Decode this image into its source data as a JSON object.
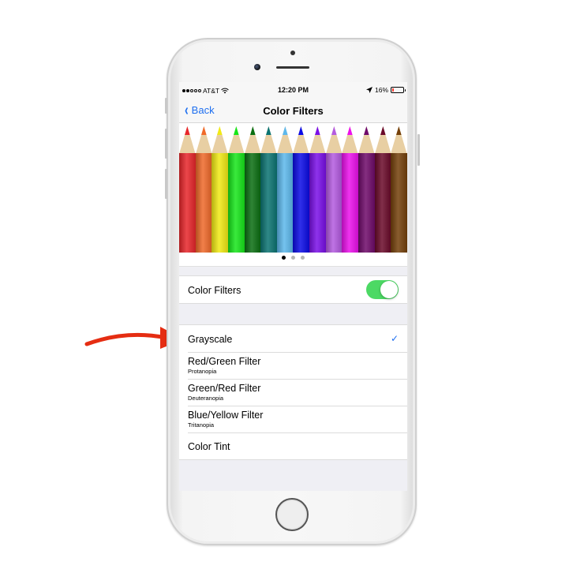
{
  "status_bar": {
    "carrier": "AT&T",
    "signal_bars_filled": 2,
    "signal_bars_total": 5,
    "time": "12:20 PM",
    "battery_percent": "16%",
    "battery_level": 0.16,
    "icons": [
      "wifi-icon",
      "location-arrow-icon",
      "battery-icon"
    ]
  },
  "nav": {
    "back_label": "Back",
    "title": "Color Filters"
  },
  "carousel": {
    "pencil_colors": [
      "#e8262b",
      "#f06a2a",
      "#f1ea14",
      "#17e61a",
      "#0a6f12",
      "#0b7472",
      "#5db8ec",
      "#0b0be6",
      "#7a0fe8",
      "#b45be0",
      "#ec10ec",
      "#6f0a6a",
      "#6b0a2a",
      "#74400a"
    ],
    "page_count": 3,
    "active_page": 1
  },
  "toggle_row": {
    "label": "Color Filters",
    "enabled": true,
    "on_color": "#4cd964"
  },
  "filters": [
    {
      "label": "Grayscale",
      "sublabel": "",
      "selected": true
    },
    {
      "label": "Red/Green Filter",
      "sublabel": "Protanopia",
      "selected": false
    },
    {
      "label": "Green/Red Filter",
      "sublabel": "Deuteranopia",
      "selected": false
    },
    {
      "label": "Blue/Yellow Filter",
      "sublabel": "Tritanopia",
      "selected": false
    },
    {
      "label": "Color Tint",
      "sublabel": "",
      "selected": false
    }
  ],
  "check_glyph": "✓",
  "annotation": {
    "arrow_color": "#e52d12",
    "points_to": "Grayscale"
  },
  "accent_color": "#1e6ff0"
}
